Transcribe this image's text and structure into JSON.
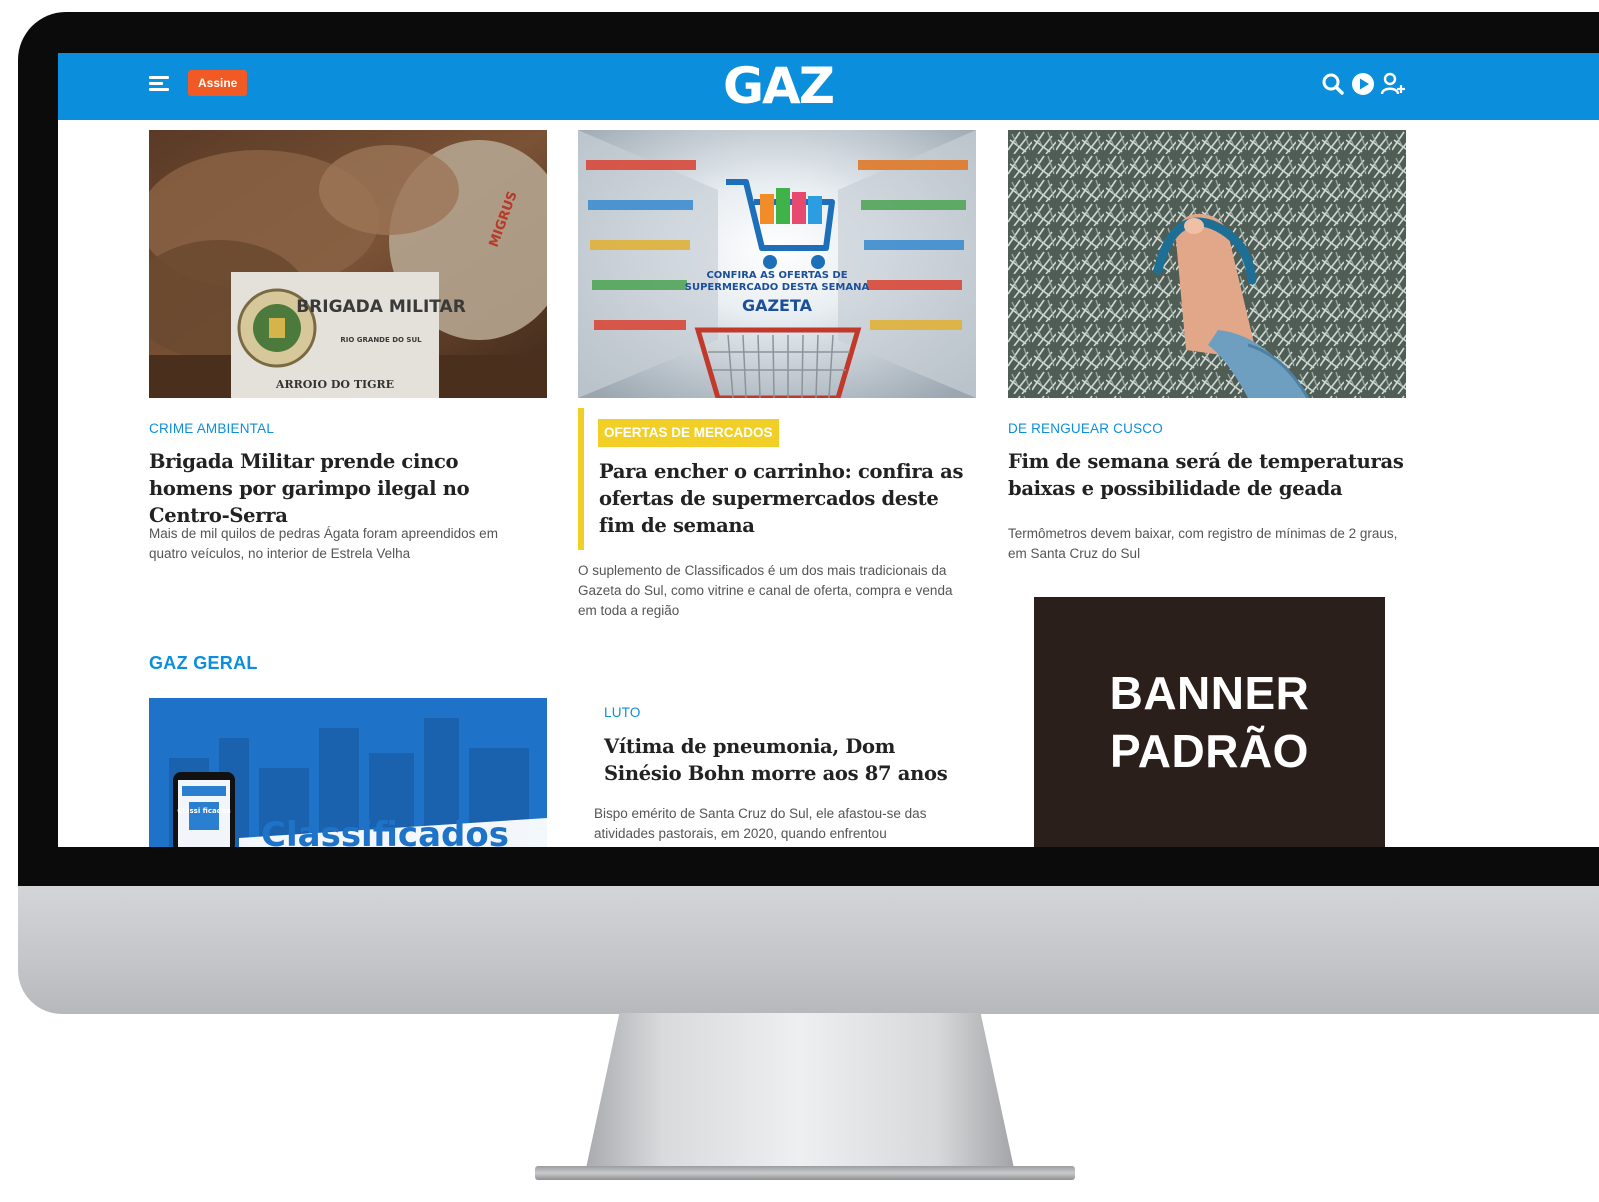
{
  "header": {
    "subscribe_label": "Assine",
    "logo_text": "GAZ",
    "brand_color": "#0b8fdc",
    "icons": [
      "search-icon",
      "play-icon",
      "user-add-icon"
    ]
  },
  "articles": [
    {
      "kicker": "CRIME AMBIENTAL",
      "headline": "Brigada Militar prende cinco homens por garimpo ilegal no Centro-Serra",
      "summary": "Mais de mil quilos de pedras Ágata foram apreendidos em quatro veículos, no interior de Estrela Velha",
      "image": {
        "sign_title": "BRIGADA MILITAR",
        "sign_subtitle": "RIO GRANDE DO SUL",
        "sign_location": "ARROIO DO TIGRE",
        "sack_text": "MIGRUS"
      }
    },
    {
      "kicker": "OFERTAS DE MERCADOS",
      "headline": "Para encher o carrinho: confira as ofertas de supermercados deste fim de semana",
      "summary": "O suplemento de Classificados é um dos mais tradicionais da Gazeta do Sul, como vitrine e canal de oferta, compra e venda em toda a região",
      "image": {
        "line1": "CONFIRA AS OFERTAS DE",
        "line2": "SUPERMERCADO DESTA SEMANA",
        "brand": "GAZETA"
      }
    },
    {
      "kicker": "DE RENGUEAR CUSCO",
      "headline": "Fim de semana será de temperaturas baixas e possibilidade de geada",
      "summary": "Termômetros devem baixar, com registro de mínimas de 2 graus, em Santa Cruz do Sul"
    }
  ],
  "section": {
    "title": "GAZ GERAL",
    "feature_image_text": "Classificados",
    "phone_text": "Classi ficados",
    "second_article": {
      "kicker": "LUTO",
      "headline": "Vítima de pneumonia, Dom Sinésio Bohn morre aos 87 anos",
      "summary": "Bispo emérito de Santa Cruz do Sul, ele afastou-se das atividades pastorais, em 2020, quando enfrentou"
    }
  },
  "banner": {
    "line1": "BANNER",
    "line2": "PADRÃO"
  }
}
